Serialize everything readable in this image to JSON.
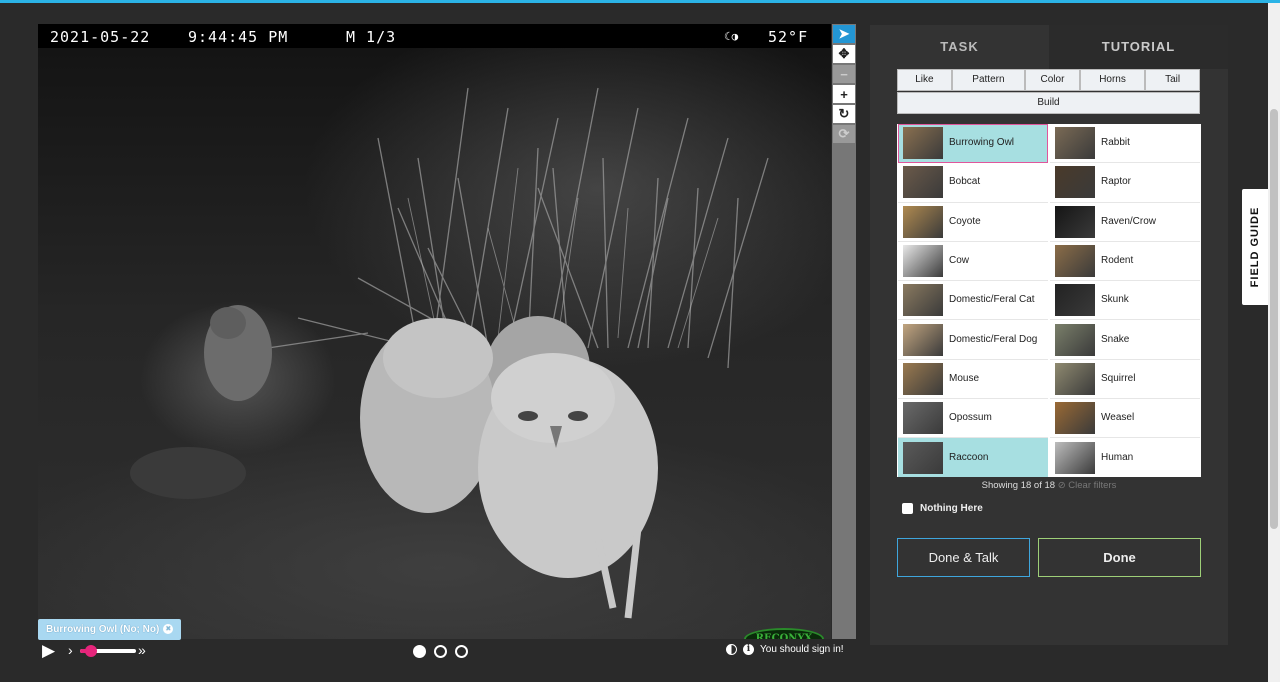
{
  "camera": {
    "date": "2021-05-22",
    "time": "9:44:45 PM",
    "frame": "M 1/3",
    "temperature": "52°F",
    "brand": "RECONYX"
  },
  "annotation": {
    "label": "Burrowing Owl (No; No)",
    "remove_symbol": "×"
  },
  "viewer_tools": [
    {
      "name": "pointer-tool",
      "icon": "pointer-icon",
      "glyph": "➤"
    },
    {
      "name": "move-tool",
      "icon": "move-icon",
      "glyph": "✥"
    },
    {
      "name": "zoom-out-tool",
      "icon": "minus-icon",
      "glyph": "−"
    },
    {
      "name": "zoom-in-tool",
      "icon": "plus-icon",
      "glyph": "+"
    },
    {
      "name": "rotate-tool",
      "icon": "rotate-icon",
      "glyph": "↻"
    },
    {
      "name": "reset-tool",
      "icon": "refresh-icon",
      "glyph": "⟳"
    }
  ],
  "playback": {
    "play_glyph": "▶",
    "slow_glyph": "›",
    "fast_glyph": "»",
    "speed_fraction": 0.2,
    "frames_total": 3,
    "current_frame": 1
  },
  "footer": {
    "info_glyph": "i",
    "signin_text": "You should sign in!"
  },
  "task": {
    "tabs": [
      "TASK",
      "TUTORIAL"
    ],
    "filters": [
      "Like",
      "Pattern",
      "Color",
      "Horns",
      "Tail"
    ],
    "filter_build": "Build",
    "choices_left": [
      "Burrowing Owl",
      "Bobcat",
      "Coyote",
      "Cow",
      "Domestic/Feral Cat",
      "Domestic/Feral Dog",
      "Mouse",
      "Opossum",
      "Raccoon"
    ],
    "choices_right": [
      "Rabbit",
      "Raptor",
      "Raven/Crow",
      "Rodent",
      "Skunk",
      "Snake",
      "Squirrel",
      "Weasel",
      "Human"
    ],
    "selected": [
      "Burrowing Owl",
      "Raccoon"
    ],
    "showing": "Showing 18 of 18",
    "clear_filters": "⊘ Clear filters",
    "nothing_here": "Nothing Here",
    "done_talk": "Done & Talk",
    "done": "Done"
  },
  "field_guide": "FIELD GUIDE",
  "colors": {
    "accent": "#2396d4",
    "selected_choice": "#a7dfe1",
    "done_border": "#9ed078",
    "talk_border": "#3fa6dd",
    "slider": "#e6257b"
  }
}
